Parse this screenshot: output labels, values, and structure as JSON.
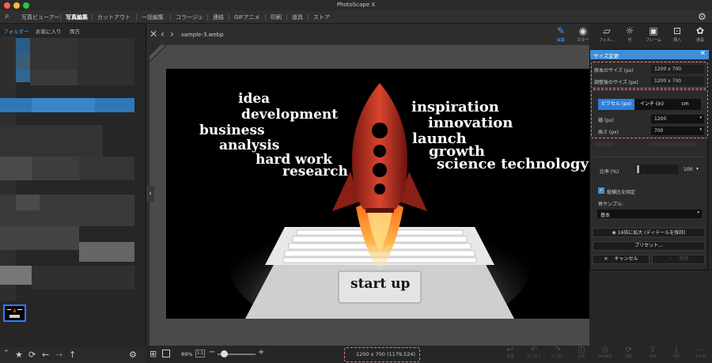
{
  "window": {
    "title": "PhotoScape X"
  },
  "menu": {
    "items": [
      "写真ビューアー",
      "写真編集",
      "カットアウト",
      "一括編集",
      "コラージュ",
      "連結",
      "GIFアニメ",
      "印刷",
      "道具",
      "ストア"
    ],
    "active": "写真編集"
  },
  "left_tabs": {
    "folder": "フォルダー",
    "favorites": "お気に入り",
    "both": "両方"
  },
  "file": {
    "name": "sample-3.webp"
  },
  "image": {
    "words": [
      "idea",
      "development",
      "business",
      "analysis",
      "hard work",
      "research",
      "inspiration",
      "innovation",
      "launch",
      "growth",
      "science technology"
    ],
    "keyboard_label": "start up"
  },
  "tools": [
    {
      "label": "編集",
      "icon": "pencil-icon"
    },
    {
      "label": "カラー",
      "icon": "color-ring-icon"
    },
    {
      "label": "フィル...",
      "icon": "filter-icon"
    },
    {
      "label": "光",
      "icon": "light-icon"
    },
    {
      "label": "フレーム",
      "icon": "frame-icon"
    },
    {
      "label": "挿入",
      "icon": "insert-icon"
    },
    {
      "label": "道具",
      "icon": "palette-icon"
    }
  ],
  "dialog": {
    "title": "サイズ変更",
    "original_size_label": "原本のサイズ (px)",
    "original_size_value": "1200 x 700",
    "adjusted_size_label": "調整後のサイズ (px)",
    "adjusted_size_value": "1200 x 700",
    "unit_tabs": [
      "ピクセル (px)",
      "インチ (in)",
      "cm"
    ],
    "active_unit": "ピクセル (px)",
    "width_label": "幅 (px)",
    "width_value": "1200",
    "height_label": "高さ (px)",
    "height_value": "700",
    "ratio_label": "比率 (%)",
    "ratio_value": "100",
    "keep_aspect_label": "縦横比を固定",
    "resample_label": "再サンプル:",
    "resample_value": "基本",
    "upscale_label": "16倍に拡大 (ディテールを保持)",
    "preset_label": "プリセット...",
    "cancel_label": "キャンセル",
    "apply_label": "適用"
  },
  "bottom_bar": {
    "zoom_label": "89%",
    "zoom_fit": "1:1",
    "status": "1200 x 700 (1179,524)"
  },
  "bottom_tools": [
    "復帰",
    "元に戻す",
    "やり直し",
    "比較",
    "原本保存",
    "回転",
    "共有",
    "保存",
    "その他"
  ],
  "colors": {
    "accent": "#3f8fd8",
    "highlight": "#f07a8a",
    "rocket": "#c43a2a"
  }
}
